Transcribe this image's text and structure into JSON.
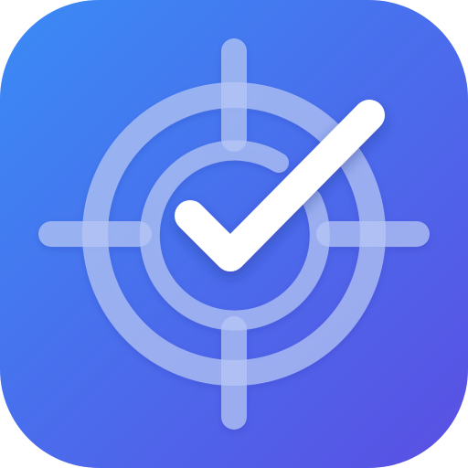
{
  "app_icon": {
    "icon": "target-check-icon",
    "background_gradient": [
      "#3A8BF6",
      "#5A4FE3"
    ],
    "reticle_color": "#B7C8F5",
    "checkmark_color": "#FFFFFF"
  }
}
